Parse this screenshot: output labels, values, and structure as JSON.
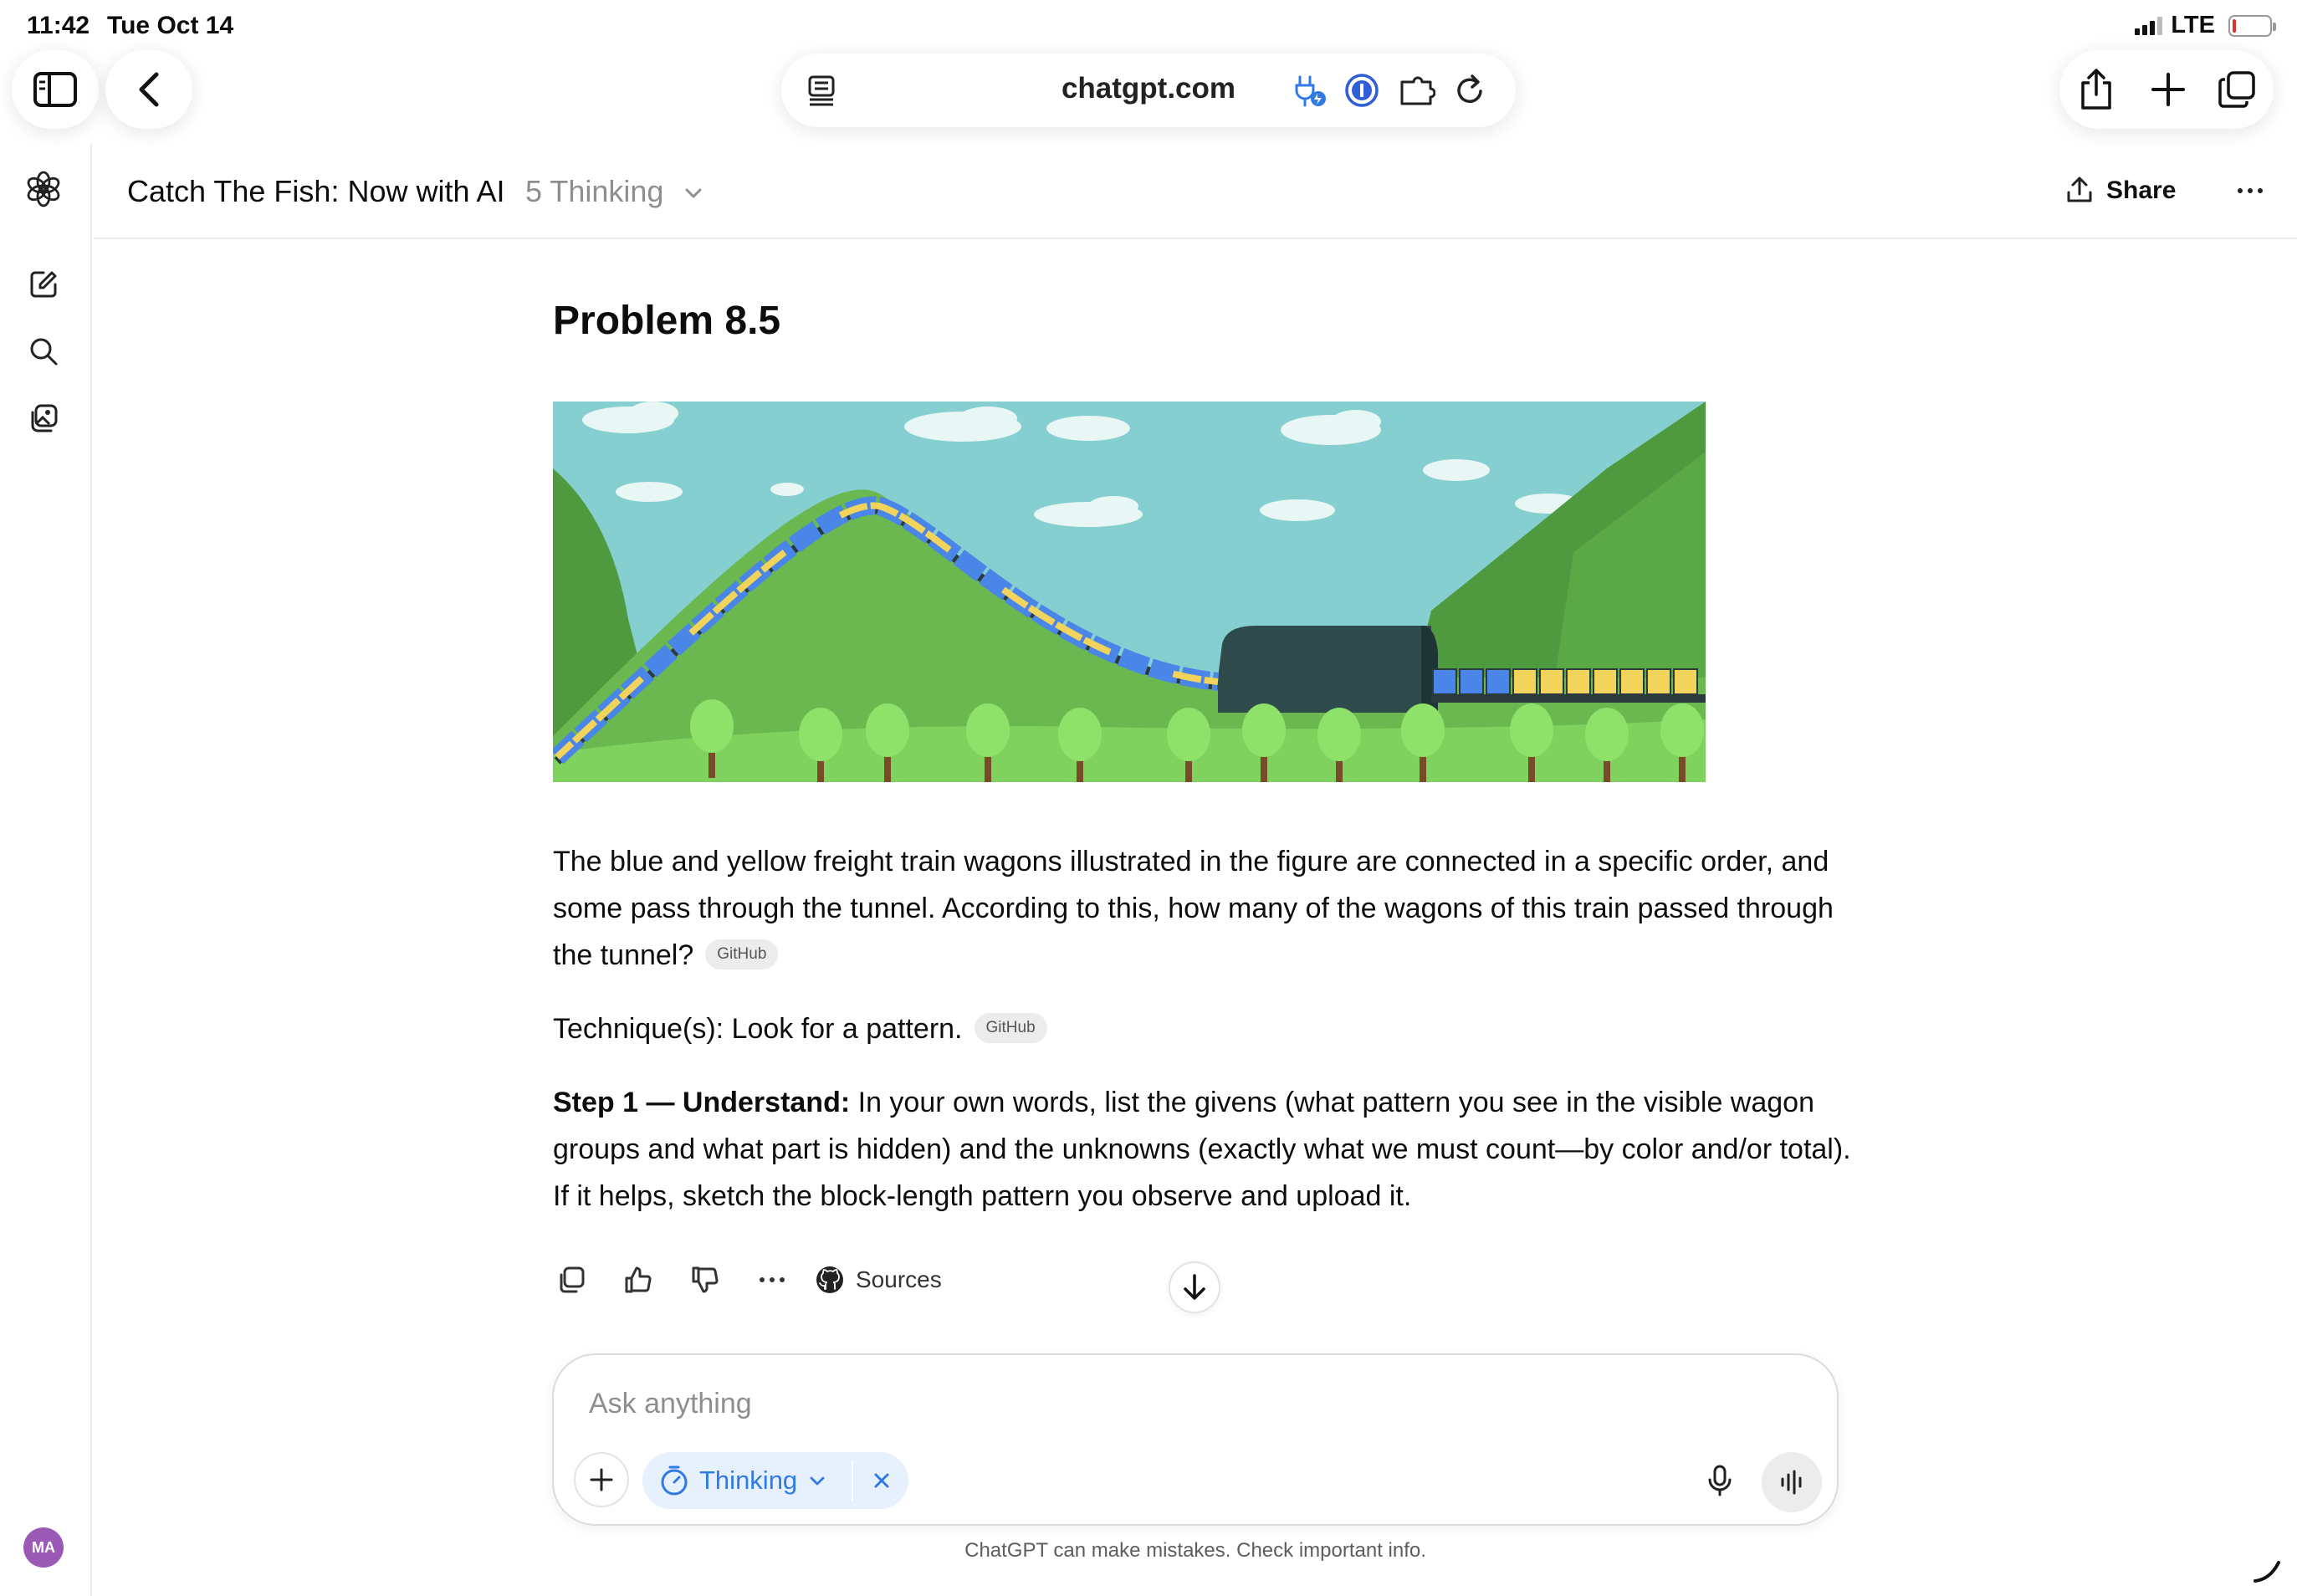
{
  "status_bar": {
    "time": "11:42",
    "date": "Tue Oct 14",
    "network": "LTE"
  },
  "browser": {
    "url": "chatgpt.com"
  },
  "header": {
    "title": "Catch The Fish: Now with AI",
    "model": "5 Thinking",
    "share_label": "Share"
  },
  "problem": {
    "title": "Problem 8.5",
    "question": "The blue and yellow freight train wagons illustrated in the figure are connected in a specific order, and some pass through the tunnel. According to this, how many of the wagons of this train passed through the tunnel?",
    "question_badge": "GitHub",
    "technique": "Technique(s): Look for a pattern.",
    "technique_badge": "GitHub",
    "step_heading": "Step 1 — Understand:",
    "step_text": " In your own words, list the givens (what pattern you see in the visible wagon groups and what part is hidden) and the unknowns (exactly what we must count—by color and/or total). If it helps, sketch the block-length pattern you observe and upload it."
  },
  "actions": {
    "sources_label": "Sources"
  },
  "composer": {
    "placeholder": "Ask anything",
    "mode_label": "Thinking"
  },
  "disclaimer": "ChatGPT can make mistakes. Check important info.",
  "user": {
    "initials": "MA"
  },
  "colors": {
    "accent_blue": "#2f7ae5",
    "pill_bg": "#e7f0fd",
    "avatar": "#9b59b6"
  }
}
